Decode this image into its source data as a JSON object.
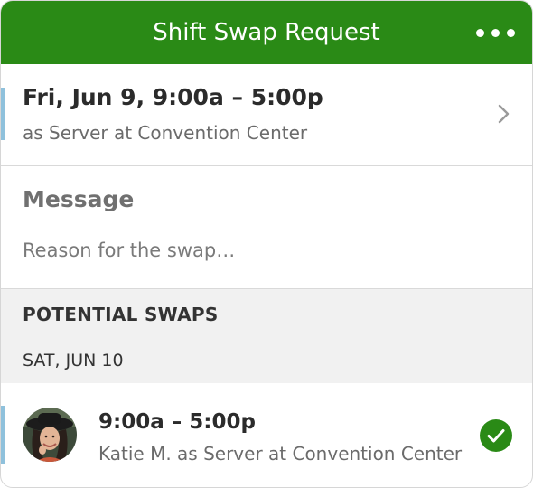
{
  "header": {
    "title": "Shift Swap Request",
    "more_icon": "more-horizontal-icon",
    "color": "#2a8a16"
  },
  "shift": {
    "date_time": "Fri, Jun 9, 9:00a – 5:00p",
    "subtitle": "as Server at Convention Center",
    "chevron_icon": "chevron-right-icon",
    "accent_color": "#8fc1dc"
  },
  "message": {
    "label": "Message",
    "value": "",
    "placeholder": "Reason for the swap…"
  },
  "potential_swaps": {
    "title": "POTENTIAL SWAPS",
    "date": "SAT, JUN 10",
    "items": [
      {
        "time": "9:00a – 5:00p",
        "subtitle": "Katie M. as Server at Convention Center",
        "avatar_icon": "avatar",
        "selected": true,
        "check_icon": "checkmark-circle-icon",
        "check_color": "#2a8a16"
      }
    ]
  }
}
